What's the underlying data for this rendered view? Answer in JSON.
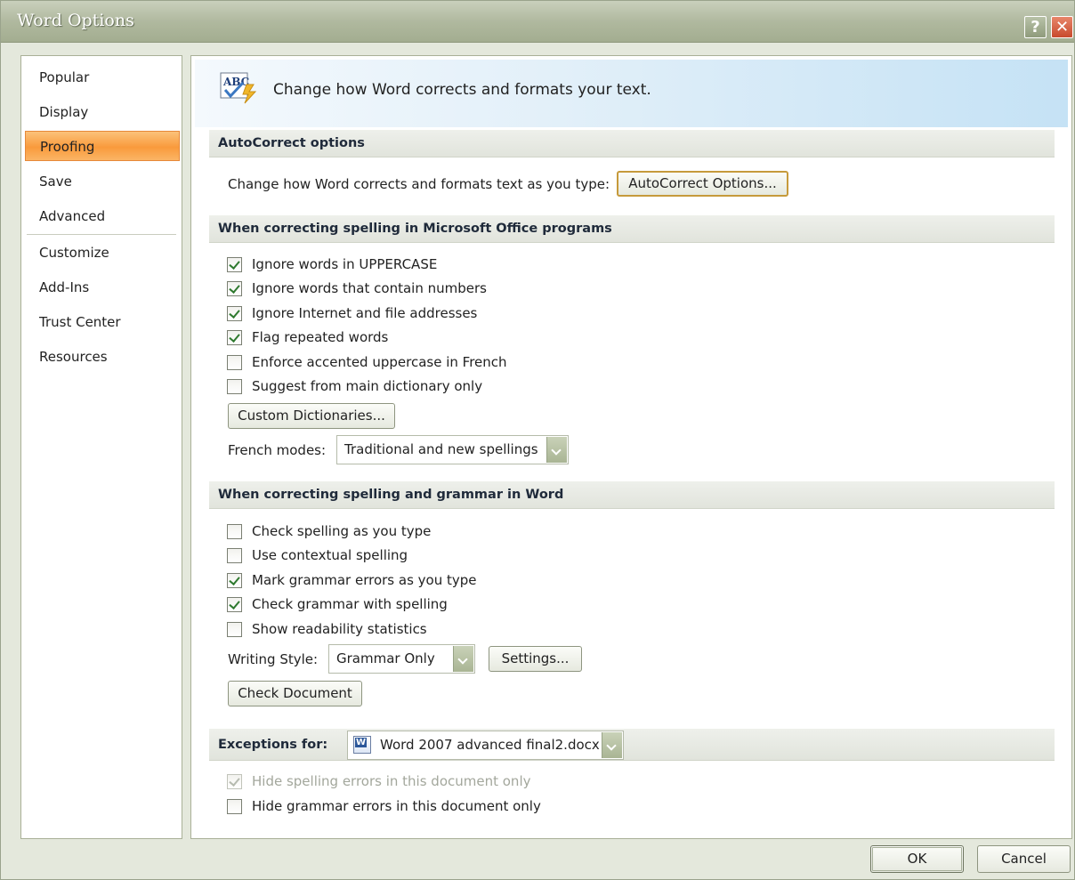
{
  "window": {
    "title": "Word Options",
    "help_label": "?",
    "close_label": "✕"
  },
  "nav": {
    "items": [
      {
        "label": "Popular",
        "selected": false
      },
      {
        "label": "Display",
        "selected": false
      },
      {
        "label": "Proofing",
        "selected": true
      },
      {
        "label": "Save",
        "selected": false
      },
      {
        "label": "Advanced",
        "selected": false
      },
      {
        "label": "Customize",
        "selected": false
      },
      {
        "label": "Add-Ins",
        "selected": false
      },
      {
        "label": "Trust Center",
        "selected": false
      },
      {
        "label": "Resources",
        "selected": false
      }
    ]
  },
  "banner": {
    "icon": "abc-check-icon",
    "icon_text": "ABC",
    "text": "Change how Word corrects and formats your text."
  },
  "autocorrect": {
    "header": "AutoCorrect options",
    "label": "Change how Word corrects and formats text as you type:",
    "button": "AutoCorrect Options..."
  },
  "office_spelling": {
    "header": "When correcting spelling in Microsoft Office programs",
    "options": [
      {
        "label": "Ignore words in UPPERCASE",
        "checked": true
      },
      {
        "label": "Ignore words that contain numbers",
        "checked": true
      },
      {
        "label": "Ignore Internet and file addresses",
        "checked": true
      },
      {
        "label": "Flag repeated words",
        "checked": true
      },
      {
        "label": "Enforce accented uppercase in French",
        "checked": false
      },
      {
        "label": "Suggest from main dictionary only",
        "checked": false
      }
    ],
    "custom_dictionaries_button": "Custom Dictionaries...",
    "french_modes_label": "French modes:",
    "french_modes_value": "Traditional and new spellings"
  },
  "word_spelling": {
    "header": "When correcting spelling and grammar in Word",
    "options": [
      {
        "label": "Check spelling as you type",
        "checked": false
      },
      {
        "label": "Use contextual spelling",
        "checked": false
      },
      {
        "label": "Mark grammar errors as you type",
        "checked": true
      },
      {
        "label": "Check grammar with spelling",
        "checked": true
      },
      {
        "label": "Show readability statistics",
        "checked": false
      }
    ],
    "writing_style_label": "Writing Style:",
    "writing_style_value": "Grammar Only",
    "settings_button": "Settings...",
    "check_document_button": "Check Document"
  },
  "exceptions": {
    "label": "Exceptions for:",
    "document": "Word 2007 advanced final2.docx",
    "options": [
      {
        "label": "Hide spelling errors in this document only",
        "checked": true,
        "disabled": true
      },
      {
        "label": "Hide grammar errors in this document only",
        "checked": false,
        "disabled": false
      }
    ]
  },
  "footer": {
    "ok_button": "OK",
    "cancel_button": "Cancel"
  }
}
